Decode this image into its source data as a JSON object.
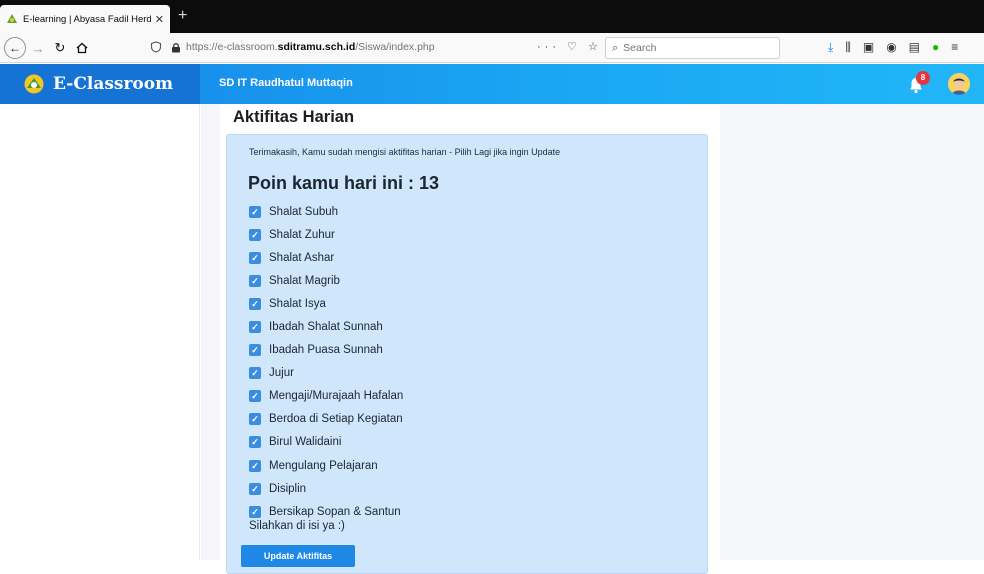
{
  "browser": {
    "tab_title": "E-learning | Abyasa Fadil Herdi",
    "tab_close": "✕",
    "new_tab": "+",
    "url_host_prefix": "https://e-classroom.",
    "url_domain": "sditramu.sch.id",
    "url_path": "/Siswa/index.php",
    "url_actions": "··· ♡ ☆",
    "search_placeholder": "Search",
    "icons": [
      "shield-icon",
      "lock-icon",
      "download-icon",
      "library-icon",
      "sidebar-icon",
      "account-icon",
      "extension-icon",
      "grammarly-icon",
      "menu-icon"
    ]
  },
  "app": {
    "brand_name": "E-Classroom",
    "school_name": "SD IT Raudhatul Muttaqin",
    "notification_count": "8",
    "colors": {
      "header": "#1aa8f3",
      "brand_bg": "#1573d6",
      "card_bg": "#cfe6fb",
      "checkbox": "#3b8de0",
      "button": "#1f88e5",
      "badge": "#e7343f"
    }
  },
  "main": {
    "title": "Aktifitas Harian",
    "thanks_text": "Terimakasih, Kamu sudah mengisi aktifitas harian - Pilih Lagi jika ingin Update",
    "points_text": "Poin kamu hari ini : 13",
    "activities": [
      {
        "label": "Shalat Subuh",
        "checked": true
      },
      {
        "label": "Shalat Zuhur",
        "checked": true
      },
      {
        "label": "Shalat Ashar",
        "checked": true
      },
      {
        "label": "Shalat Magrib",
        "checked": true
      },
      {
        "label": "Shalat Isya",
        "checked": true
      },
      {
        "label": "Ibadah Shalat Sunnah",
        "checked": true
      },
      {
        "label": "Ibadah Puasa Sunnah",
        "checked": true
      },
      {
        "label": "Jujur",
        "checked": true
      },
      {
        "label": "Mengaji/Murajaah Hafalan",
        "checked": true
      },
      {
        "label": "Berdoa di Setiap Kegiatan",
        "checked": true
      },
      {
        "label": "Birul Walidaini",
        "checked": true
      },
      {
        "label": "Mengulang Pelajaran",
        "checked": true
      },
      {
        "label": "Disiplin",
        "checked": true
      },
      {
        "label": "Bersikap Sopan & Santun",
        "checked": true
      }
    ],
    "footnote": "Silahkan di isi ya :)",
    "button_label": "Update Aktifitas"
  }
}
